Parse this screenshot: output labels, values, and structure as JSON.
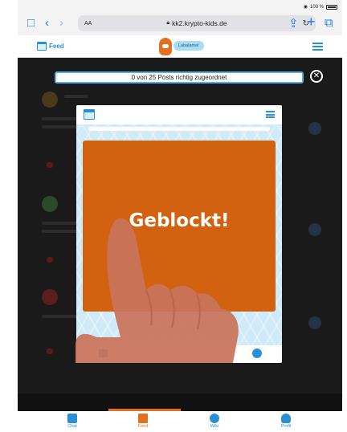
{
  "status_bar": {
    "battery": "100 %"
  },
  "browser": {
    "text_size_label": "AA",
    "url": "kk2.krypto-kids.de",
    "icons": [
      "sidebar-icon",
      "back-icon",
      "forward-icon",
      "lock-icon",
      "reload-icon",
      "share-icon",
      "new-tab-icon",
      "tabs-icon"
    ]
  },
  "app_header": {
    "section_label": "Feed",
    "mascot_label": "Labalama!"
  },
  "progress": {
    "text": "0 von 25 Posts richtig zugeordnet"
  },
  "modal": {
    "status_text": "Geblockt!"
  },
  "bottom_nav": {
    "items": [
      {
        "label": "Chat",
        "icon": "chat-icon"
      },
      {
        "label": "Feed",
        "icon": "feed-icon",
        "active": true
      },
      {
        "label": "Wiki",
        "icon": "wiki-icon"
      },
      {
        "label": "Profil",
        "icon": "profile-icon"
      }
    ]
  },
  "colors": {
    "accent_blue": "#2b8fd6",
    "accent_orange": "#e2701e",
    "blocked_card": "#d2620f",
    "overlay": "#1a1a1a"
  }
}
